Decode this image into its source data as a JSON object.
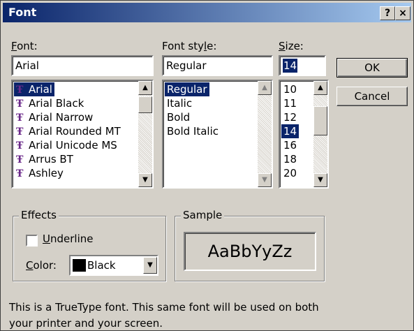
{
  "window": {
    "title": "Font",
    "help_button": "?",
    "close_button": "×"
  },
  "font_field": {
    "label": "Font:",
    "value": "Arial",
    "items": [
      {
        "label": "Arial",
        "selected": true
      },
      {
        "label": "Arial Black",
        "selected": false
      },
      {
        "label": "Arial Narrow",
        "selected": false
      },
      {
        "label": "Arial Rounded MT",
        "selected": false
      },
      {
        "label": "Arial Unicode MS",
        "selected": false
      },
      {
        "label": "Arrus BT",
        "selected": false
      },
      {
        "label": "Ashley",
        "selected": false
      }
    ],
    "item_icon": "truetype-icon",
    "item_icon_glyph": "Ŧ"
  },
  "style_field": {
    "label": "Font style:",
    "value": "Regular",
    "items": [
      {
        "label": "Regular",
        "selected": true
      },
      {
        "label": "Italic",
        "selected": false
      },
      {
        "label": "Bold",
        "selected": false
      },
      {
        "label": "Bold Italic",
        "selected": false
      }
    ]
  },
  "size_field": {
    "label": "Size:",
    "value": "14",
    "items": [
      {
        "label": "10",
        "selected": false
      },
      {
        "label": "11",
        "selected": false
      },
      {
        "label": "12",
        "selected": false
      },
      {
        "label": "14",
        "selected": true
      },
      {
        "label": "16",
        "selected": false
      },
      {
        "label": "18",
        "selected": false
      },
      {
        "label": "20",
        "selected": false
      }
    ]
  },
  "buttons": {
    "ok": "OK",
    "cancel": "Cancel"
  },
  "effects": {
    "title": "Effects",
    "underline_label": "Underline",
    "underline_checked": false,
    "color_label": "Color:",
    "color_value": "Black",
    "color_swatch": "#000000"
  },
  "sample": {
    "title": "Sample",
    "text": "AaBbYyZz"
  },
  "info": {
    "line1": "This is a TrueType font. This same font will be used on both",
    "line2": "your printer and your screen."
  },
  "colors": {
    "title_bar_start": "#0a246a",
    "title_bar_end": "#a6caf0",
    "dialog_bg": "#d4d0c8",
    "selection": "#0a246a",
    "truetype_icon": "#6b2a8a"
  }
}
